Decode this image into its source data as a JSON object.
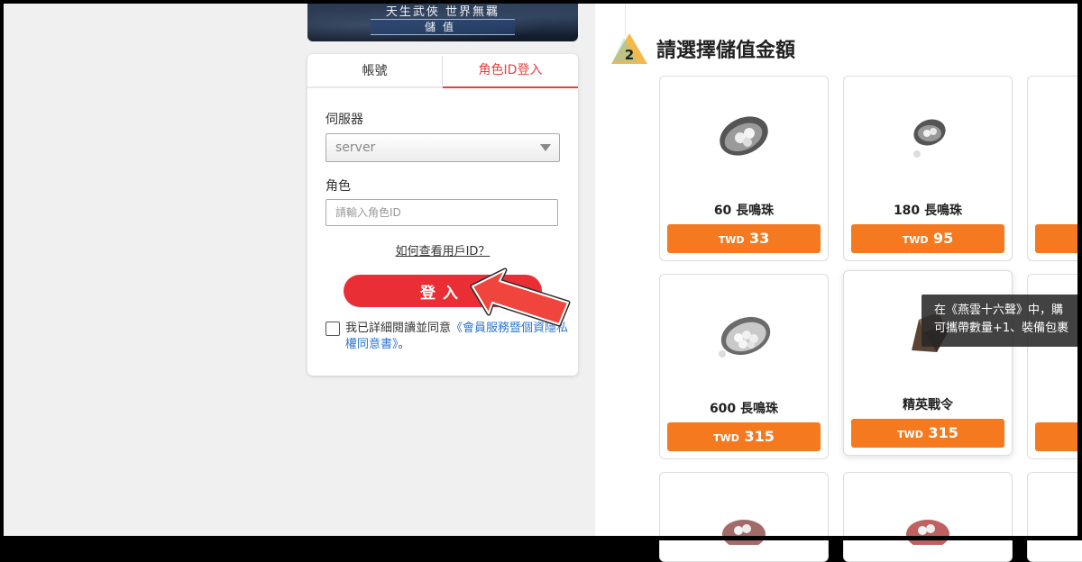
{
  "banner": {
    "title": "天生武俠 世界無羈",
    "subtitle": "儲值"
  },
  "login": {
    "tabs": [
      {
        "label": "帳號",
        "active": false
      },
      {
        "label": "角色ID登入",
        "active": true
      }
    ],
    "server_label": "伺服器",
    "server_value": "server",
    "role_label": "角色",
    "role_placeholder": "請輸入角色ID",
    "howto_link": "如何查看用戶ID？",
    "login_button": "登入",
    "agree_text": "我已詳細閱讀並同意",
    "agree_link": "《會員服務暨個資隱私權同意書》",
    "agree_end": "。"
  },
  "step": {
    "number": "2",
    "title": "請選擇儲值金額"
  },
  "products": [
    {
      "name": "60 長鳴珠",
      "currency": "TWD",
      "amount": "33",
      "icon": "pearl-shell-icon"
    },
    {
      "name": "180 長鳴珠",
      "currency": "TWD",
      "amount": "95",
      "icon": "pearl-shell-icon"
    },
    {
      "name": "600 長鳴珠",
      "currency": "TWD",
      "amount": "315",
      "icon": "pearl-shell-icon"
    },
    {
      "name": "精英戰令",
      "currency": "TWD",
      "amount": "315",
      "icon": "token-icon"
    }
  ],
  "tooltip": {
    "line1": "在《燕雲十六聲》中，購",
    "line2": "可攜帶數量+1、裝備包裹"
  },
  "colors": {
    "accent_red": "#ea2e35",
    "price_orange": "#f5791e",
    "link_blue": "#2a76d2"
  }
}
